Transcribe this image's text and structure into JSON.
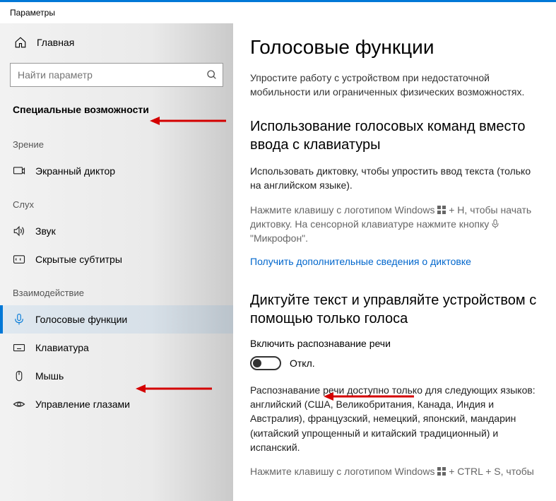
{
  "window_title": "Параметры",
  "sidebar": {
    "home_label": "Главная",
    "search_placeholder": "Найти параметр",
    "category": "Специальные возможности",
    "groups": [
      {
        "label": "Зрение",
        "items": [
          {
            "id": "narrator",
            "label": "Экранный диктор"
          }
        ]
      },
      {
        "label": "Слух",
        "items": [
          {
            "id": "sound",
            "label": "Звук"
          },
          {
            "id": "captions",
            "label": "Скрытые субтитры"
          }
        ]
      },
      {
        "label": "Взаимодействие",
        "items": [
          {
            "id": "speech",
            "label": "Голосовые функции"
          },
          {
            "id": "keyboard",
            "label": "Клавиатура"
          },
          {
            "id": "mouse",
            "label": "Мышь"
          },
          {
            "id": "eye",
            "label": "Управление глазами"
          }
        ]
      }
    ]
  },
  "page": {
    "title": "Голосовые функции",
    "description": "Упростите работу с устройством при недостаточной мобильности или ограниченных физических возможностях.",
    "section1": {
      "title": "Использование голосовых команд вместо ввода с клавиатуры",
      "body": "Использовать диктовку, чтобы упростить ввод текста (только на английском языке).",
      "hint_1": "Нажмите клавишу с логотипом Windows ",
      "hint_2": " + H, чтобы начать диктовку.  На сенсорной клавиатуре нажмите кнопку ",
      "hint_3": " \"Микрофон\".",
      "link": "Получить дополнительные сведения о диктовке"
    },
    "section2": {
      "title": "Диктуйте текст и управляйте устройством с помощью только голоса",
      "toggle_label": "Включить распознавание речи",
      "toggle_state": "Откл.",
      "languages_note": "Распознавание речи доступно только для следующих языков: английский (США, Великобритания, Канада, Индия и Австралия), французский, немецкий, японский, мандарин (китайский упрощенный и китайский традиционный) и испанский.",
      "hint_1": "Нажмите клавишу с логотипом Windows ",
      "hint_2": " + CTRL + S, чтобы"
    }
  }
}
